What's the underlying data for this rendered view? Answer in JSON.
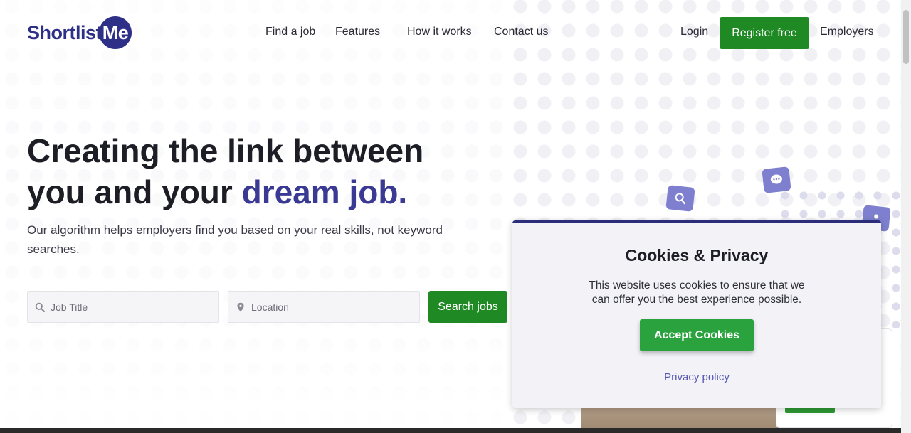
{
  "brand": {
    "name_part1": "Shortlist",
    "name_part2": "Me"
  },
  "nav": {
    "find_job": "Find a job",
    "features": "Features",
    "how_it_works": "How it works",
    "contact": "Contact us",
    "login": "Login",
    "register": "Register free",
    "employers": "Employers"
  },
  "hero": {
    "title_line1": "Creating the link between",
    "title_line2_a": "you and your ",
    "title_line2_b": "dream job.",
    "subtitle": "Our algorithm helps employers find you based on your real skills, not keyword searches."
  },
  "search": {
    "job_title_placeholder": "Job Title",
    "location_placeholder": "Location",
    "button": "Search jobs"
  },
  "cookie": {
    "title": "Cookies & Privacy",
    "text": "This website uses cookies to ensure that we can offer you the best experience possible.",
    "accept": "Accept Cookies",
    "privacy": "Privacy policy"
  },
  "colors": {
    "brand": "#2e2f86",
    "green": "#1f8a24",
    "accent": "#3a3a94"
  }
}
